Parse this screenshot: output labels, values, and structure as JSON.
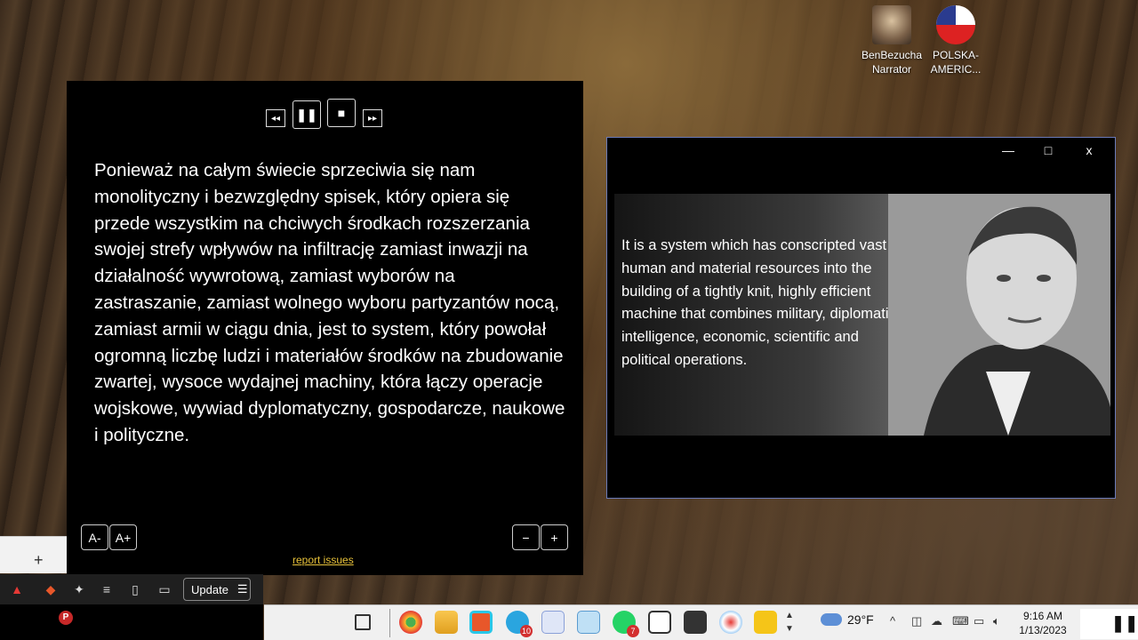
{
  "desktop": {
    "icons": [
      {
        "label_line1": "BenBezucha",
        "label_line2": "Narrator"
      },
      {
        "label_line1": "POLSKA-",
        "label_line2": "AMERIC..."
      }
    ]
  },
  "reader": {
    "controls": {
      "prev": "◂◂",
      "pause": "❚❚",
      "stop": "■",
      "next": "▸▸"
    },
    "text": "Ponieważ na całym świecie sprzeciwia się nam monolityczny i bezwzględny spisek, który opiera się przede wszystkim na chciwych środkach rozszerzania swojej strefy wpływów na infiltrację zamiast inwazji na działalność wywrotową, zamiast wyborów na zastraszanie, zamiast wolnego wyboru partyzantów nocą, zamiast armii w ciągu dnia, jest to system, który powołał ogromną liczbę ludzi i materiałów środków na zbudowanie zwartej, wysoce wydajnej machiny, która łączy operacje wojskowe, wywiad dyplomatyczny, gospodarcze, naukowe i polityczne.",
    "font_decrease": "A-",
    "font_increase": "A+",
    "speed_decrease": "−",
    "speed_increase": "+",
    "report_link": "report issues"
  },
  "video_window": {
    "minimize": "—",
    "maximize": "□",
    "close": "x",
    "quote": "It is a system which has conscripted vast human and material resources into the building of a tightly knit, highly efficient machine that combines military, diplomatic, intelligence, economic, scientific and political operations."
  },
  "browser": {
    "new_tab": "+",
    "update_label": "Update",
    "update_menu": "☰",
    "dock_badge": "P"
  },
  "taskbar": {
    "telegram_badge": "10",
    "whatsapp_badge": "7",
    "temperature": "29°F",
    "time": "9:16 AM",
    "date": "1/13/2023",
    "pause": "❚❚"
  },
  "colors": {
    "report_link": "#e8c23a",
    "video_border": "#6a7ab8",
    "taskbar_bg": "#f0f0f0"
  }
}
